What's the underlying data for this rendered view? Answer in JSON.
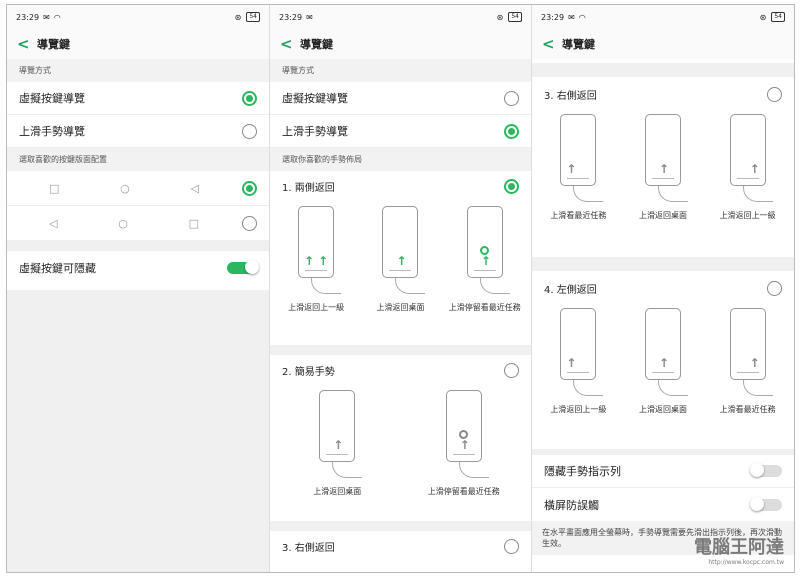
{
  "status": {
    "time": "23:29",
    "battery": "54"
  },
  "header": {
    "back": "<",
    "title": "導覽鍵"
  },
  "panel1": {
    "section1": "導覽方式",
    "opt1": "虛擬按鍵導覽",
    "opt2": "上滑手勢導覽",
    "section2": "選取喜歡的按鍵版面配置",
    "toggle_label": "虛擬按鍵可隱藏"
  },
  "panel2": {
    "section1": "導覽方式",
    "opt1": "虛擬按鍵導覽",
    "opt2": "上滑手勢導覽",
    "section2": "選取你喜歡的手勢佈局",
    "g1": {
      "title": "1. 兩側返回",
      "caps": [
        "上滑返回上一級",
        "上滑返回桌面",
        "上滑停留看最近任務"
      ]
    },
    "g2": {
      "title": "2. 簡易手勢",
      "caps": [
        "上滑返回桌面",
        "上滑停留看最近任務"
      ]
    },
    "g3": {
      "title": "3. 右側返回"
    }
  },
  "panel3": {
    "g3": {
      "title": "3. 右側返回",
      "caps": [
        "上滑看最近任務",
        "上滑返回桌面",
        "上滑返回上一級"
      ]
    },
    "g4": {
      "title": "4. 左側返回",
      "caps": [
        "上滑返回上一級",
        "上滑返回桌面",
        "上滑看最近任務"
      ]
    },
    "hide": "隱藏手勢指示列",
    "anti": "橫屏防誤觸",
    "note": "在水平畫面應用全螢幕時，手勢導覽需要先滑出指示列後，再次滑動生效。"
  },
  "watermark": {
    "text": "電腦王阿達",
    "url": "http://www.kocpc.com.tw"
  },
  "colors": {
    "accent": "#2bb660"
  }
}
